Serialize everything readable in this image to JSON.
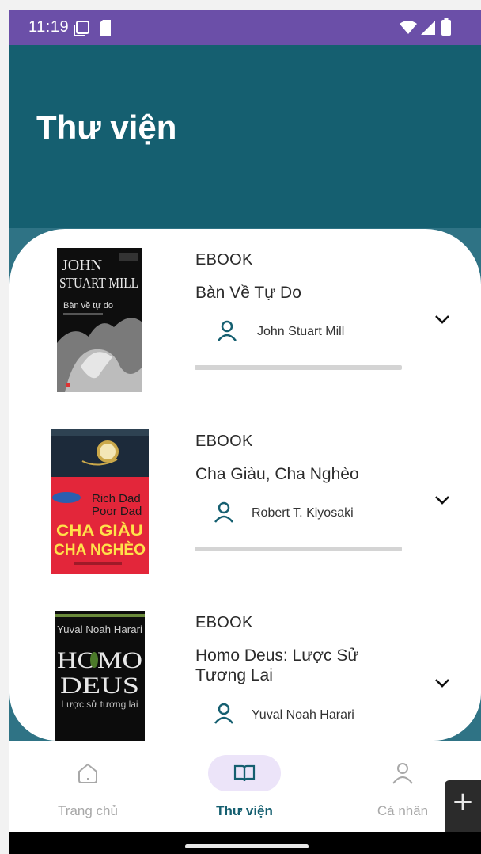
{
  "status_bar": {
    "time": "11:19",
    "icons": [
      "screen-icon",
      "sd-card-icon",
      "wifi-icon",
      "signal-icon",
      "battery-icon"
    ]
  },
  "header": {
    "title": "Thư viện"
  },
  "books": [
    {
      "type": "EBOOK",
      "title": "Bàn Về Tự Do",
      "author": "John Stuart Mill",
      "progress": 0,
      "cover": {
        "line1": "JOHN",
        "line2": "STUART MILL",
        "line3": "Bàn về tự do"
      }
    },
    {
      "type": "EBOOK",
      "title": "Cha Giàu, Cha Nghèo",
      "author": "Robert T. Kiyosaki",
      "progress": 0,
      "cover": {
        "line1": "Rich Dad",
        "line2": "Poor Dad",
        "line3": "CHA GIÀU",
        "line4": "CHA NGHÈO"
      }
    },
    {
      "type": "EBOOK",
      "title": "Homo Deus: Lược Sử Tương Lai",
      "author": "Yuval Noah Harari",
      "cover": {
        "line1": "Yuval Noah Harari",
        "line2": "HOMO",
        "line3": "DEUS",
        "line4": "Lược sử tương lai"
      }
    }
  ],
  "nav": {
    "items": [
      {
        "label": "Trang chủ",
        "icon": "home-icon",
        "active": false
      },
      {
        "label": "Thư viện",
        "icon": "book-open-icon",
        "active": true
      },
      {
        "label": "Cá nhân",
        "icon": "person-icon",
        "active": false
      }
    ]
  },
  "zoom": {
    "plus": "+",
    "minus": "−"
  },
  "colors": {
    "status_bar": "#6b4fa8",
    "app_bar": "#155f70",
    "accent": "#155f70",
    "nav_active_bg": "#ece4f9",
    "nav_inactive": "#a8a8a8"
  }
}
